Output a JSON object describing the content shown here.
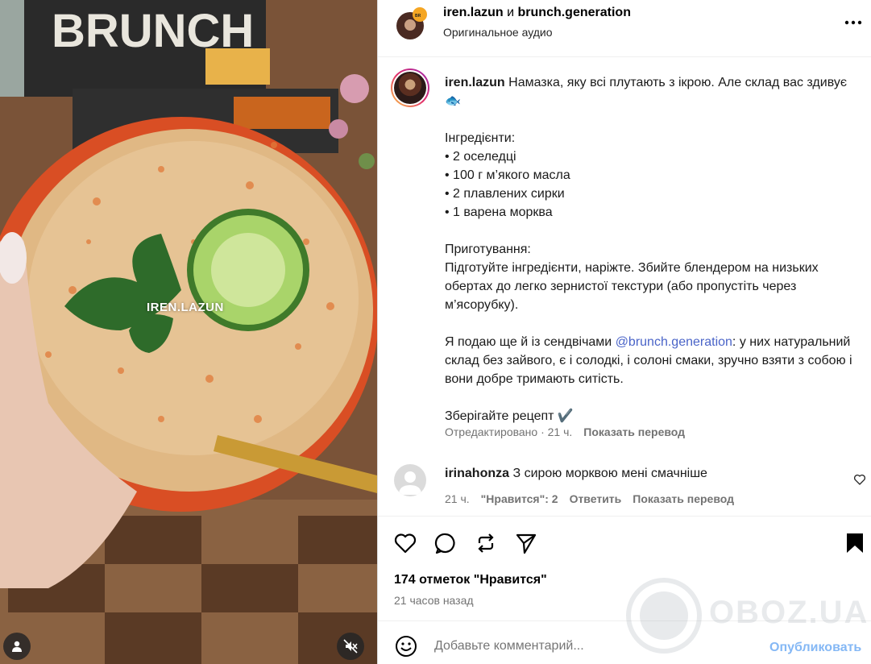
{
  "media": {
    "watermark": "IREN.LAZUN",
    "box_brand_text": "BRUNCH",
    "tag_icon": "person-icon",
    "mute_icon": "muted-speaker-icon"
  },
  "header": {
    "user1": "iren.lazun",
    "connector": " и ",
    "user2": "brunch.generation",
    "audio": "Оригинальное аудио",
    "more_icon": "more-horizontal-icon"
  },
  "caption": {
    "username": "iren.lazun",
    "line1": " Намазка, яку всі плутають з ікрою. Але склад вас здивує 🐟",
    "ingredients_title": "Інгредієнти:",
    "ingredients": [
      "• 2 оселедці",
      "• 100 г м’якого масла",
      "• 2 плавлених сирки",
      "• 1 варена морква"
    ],
    "prep_title": "Приготування:",
    "prep_text": "Підготуйте інгредієнти, наріжте. Збийте блендером на низьких обертах до легко зернистої текстури (або пропустіть через м’ясорубку).",
    "serve_before": "Я подаю ще й із сендвічами ",
    "serve_mention": "@brunch.generation",
    "serve_after": ": у них натуральний склад без зайвого, є і солодкі, і солоні смаки, зручно взяти з собою і вони добре тримають ситість.",
    "save_text": "Зберігайте рецепт ✔️",
    "edited": "Отредактировано · 21 ч.",
    "translate": "Показать перевод"
  },
  "comment": {
    "username": "irinahonza",
    "text": " З сирою морквою мені смачніше",
    "time": "21 ч.",
    "likes": "\"Нравится\": 2",
    "reply": "Ответить",
    "translate": "Показать перевод"
  },
  "actions": {
    "likes_count": "174 отметок \"Нравится\"",
    "time_ago": "21 часов назад"
  },
  "compose": {
    "placeholder": "Добавьте комментарий...",
    "publish": "Опубликовать"
  },
  "site_watermark": "OBOZ.UA",
  "colors": {
    "accent_link": "#4a64c8",
    "publish": "#85b8f5",
    "secondary_text": "#737373"
  }
}
